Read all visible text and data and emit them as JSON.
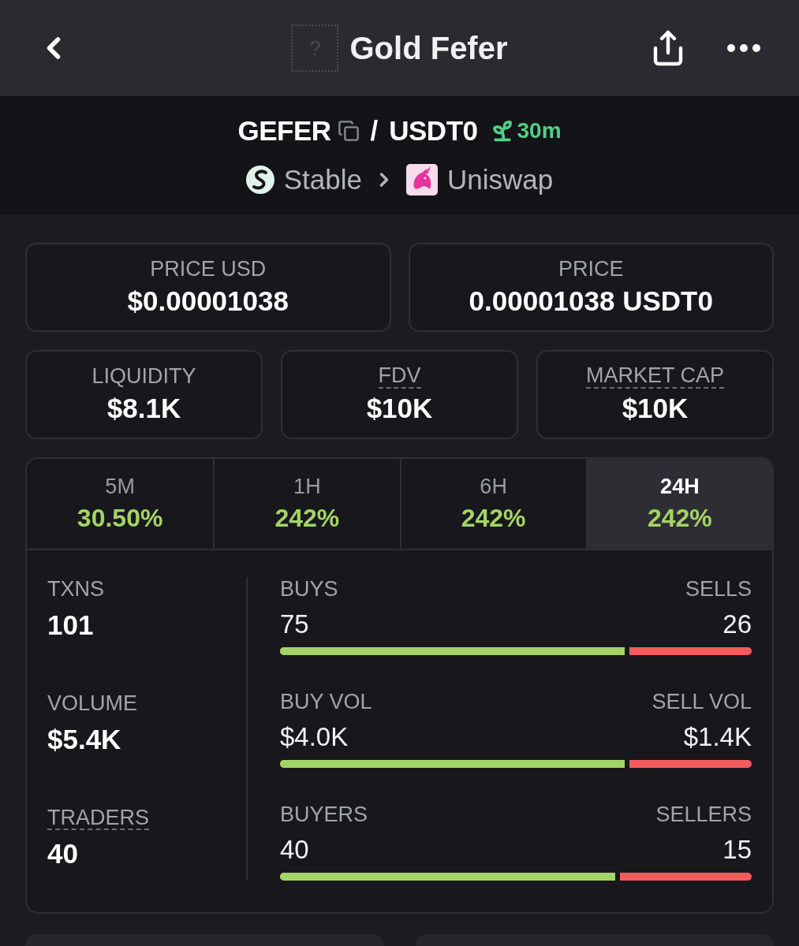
{
  "header": {
    "logo_placeholder": "?",
    "title": "Gold Fefer"
  },
  "pair": {
    "base": "GEFER",
    "separator": "/",
    "quote": "USDT0",
    "age": "30m",
    "chain": "Stable",
    "dex": "Uniswap"
  },
  "price_cards": [
    {
      "label": "PRICE USD",
      "value": "$0.00001038",
      "has_tooltip": false
    },
    {
      "label": "PRICE",
      "value": "0.00001038 USDT0",
      "has_tooltip": false
    }
  ],
  "metric_cards": [
    {
      "label": "LIQUIDITY",
      "value": "$8.1K",
      "has_tooltip": false
    },
    {
      "label": "FDV",
      "value": "$10K",
      "has_tooltip": true
    },
    {
      "label": "MARKET CAP",
      "value": "$10K",
      "has_tooltip": true
    }
  ],
  "timeframe_tabs": [
    {
      "label": "5M",
      "change": "30.50%",
      "selected": false
    },
    {
      "label": "1H",
      "change": "242%",
      "selected": false
    },
    {
      "label": "6H",
      "change": "242%",
      "selected": false
    },
    {
      "label": "24H",
      "change": "242%",
      "selected": true
    }
  ],
  "totals": [
    {
      "label": "TXNS",
      "value": "101",
      "has_tooltip": false
    },
    {
      "label": "VOLUME",
      "value": "$5.4K",
      "has_tooltip": false
    },
    {
      "label": "TRADERS",
      "value": "40",
      "has_tooltip": true
    }
  ],
  "splits": [
    {
      "buy_label": "BUYS",
      "buy_value": "75",
      "sell_label": "SELLS",
      "sell_value": "26",
      "level": 0.74
    },
    {
      "buy_label": "BUY VOL",
      "buy_value": "$4.0K",
      "sell_label": "SELL VOL",
      "sell_value": "$1.4K",
      "level": 0.74
    },
    {
      "buy_label": "BUYERS",
      "buy_value": "40",
      "sell_label": "SELLERS",
      "sell_value": "15",
      "level": 0.72
    }
  ]
}
